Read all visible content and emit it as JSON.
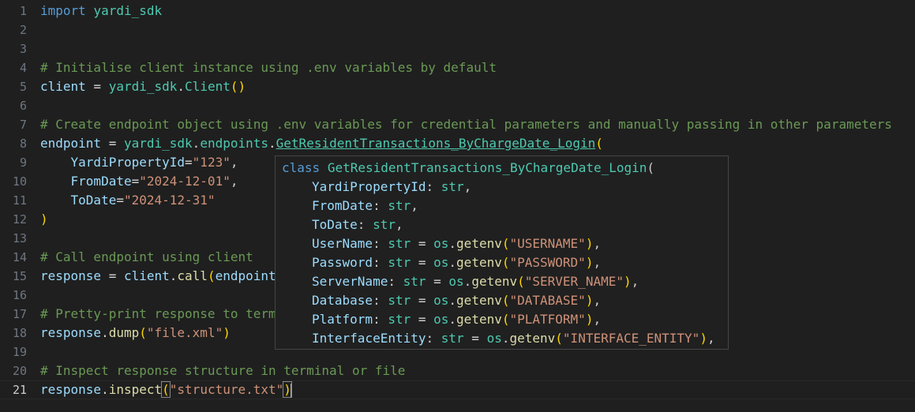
{
  "editor": {
    "active_line": 21,
    "line_numbers": [
      "1",
      "2",
      "3",
      "4",
      "5",
      "6",
      "7",
      "8",
      "9",
      "10",
      "11",
      "12",
      "13",
      "14",
      "15",
      "16",
      "17",
      "18",
      "19",
      "20",
      "21"
    ],
    "lines": {
      "l1": {
        "kw": "import",
        "mod": "yardi_sdk"
      },
      "l4": {
        "comment": "# Initialise client instance using .env variables by default"
      },
      "l5": {
        "var": "client",
        "eq": " = ",
        "mod": "yardi_sdk",
        "dot": ".",
        "cls": "Client",
        "open": "(",
        "close": ")"
      },
      "l7": {
        "comment": "# Create endpoint object using .env variables for credential parameters and manually passing in other parameters"
      },
      "l8": {
        "var": "endpoint",
        "eq": " = ",
        "mod": "yardi_sdk",
        "dot1": ".",
        "attr": "endpoints",
        "dot2": ".",
        "cls": "GetResidentTransactions_ByChargeDate_Login",
        "open": "("
      },
      "l9": {
        "param": "YardiPropertyId",
        "eq": "=",
        "val": "\"123\"",
        "comma": ","
      },
      "l10": {
        "param": "FromDate",
        "eq": "=",
        "val": "\"2024-12-01\"",
        "comma": ","
      },
      "l11": {
        "param": "ToDate",
        "eq": "=",
        "val": "\"2024-12-31\""
      },
      "l12": {
        "close": ")"
      },
      "l14": {
        "comment": "# Call endpoint using client"
      },
      "l15": {
        "var": "response",
        "eq": " = ",
        "obj": "client",
        "dot": ".",
        "fn": "call",
        "open": "(",
        "arg": "endpoint"
      },
      "l17": {
        "comment": "# Pretty-print response to term"
      },
      "l18": {
        "obj": "response",
        "dot": ".",
        "fn": "dump",
        "open": "(",
        "val": "\"file.xml\"",
        "close": ")"
      },
      "l20": {
        "comment": "# Inspect response structure in terminal or file"
      },
      "l21": {
        "obj": "response",
        "dot": ".",
        "fn": "inspect",
        "open": "(",
        "val": "\"structure.txt\"",
        "close": ")"
      }
    }
  },
  "hover": {
    "keyword": "class",
    "class_name": "GetResidentTransactions_ByChargeDate_Login",
    "open": "(",
    "params": [
      {
        "name": "YardiPropertyId",
        "colon": ": ",
        "type": "str",
        "rest": ","
      },
      {
        "name": "FromDate",
        "colon": ": ",
        "type": "str",
        "rest": ","
      },
      {
        "name": "ToDate",
        "colon": ": ",
        "type": "str",
        "rest": ","
      },
      {
        "name": "UserName",
        "colon": ": ",
        "type": "str",
        "eq": " = ",
        "mod": "os",
        "dot": ".",
        "fn": "getenv",
        "open": "(",
        "val": "\"USERNAME\"",
        "close": ")",
        "comma": ","
      },
      {
        "name": "Password",
        "colon": ": ",
        "type": "str",
        "eq": " = ",
        "mod": "os",
        "dot": ".",
        "fn": "getenv",
        "open": "(",
        "val": "\"PASSWORD\"",
        "close": ")",
        "comma": ","
      },
      {
        "name": "ServerName",
        "colon": ": ",
        "type": "str",
        "eq": " = ",
        "mod": "os",
        "dot": ".",
        "fn": "getenv",
        "open": "(",
        "val": "\"SERVER_NAME\"",
        "close": ")",
        "comma": ","
      },
      {
        "name": "Database",
        "colon": ": ",
        "type": "str",
        "eq": " = ",
        "mod": "os",
        "dot": ".",
        "fn": "getenv",
        "open": "(",
        "val": "\"DATABASE\"",
        "close": ")",
        "comma": ","
      },
      {
        "name": "Platform",
        "colon": ": ",
        "type": "str",
        "eq": " = ",
        "mod": "os",
        "dot": ".",
        "fn": "getenv",
        "open": "(",
        "val": "\"PLATFORM\"",
        "close": ")",
        "comma": ","
      },
      {
        "name": "InterfaceEntity",
        "colon": ": ",
        "type": "str",
        "eq": " = ",
        "mod": "os",
        "dot": ".",
        "fn": "getenv",
        "open": "(",
        "val": "\"INTERFACE_ENTITY\"",
        "close": ")",
        "comma": ","
      }
    ]
  },
  "colors": {
    "background": "#1f1f1f",
    "keyword": "#569cd6",
    "type": "#4ec9b0",
    "variable": "#9cdcfe",
    "function": "#dcdcaa",
    "string": "#ce9178",
    "comment": "#6a9955",
    "bracket_level1": "#ffd700",
    "bracket_level2": "#da70d6"
  }
}
